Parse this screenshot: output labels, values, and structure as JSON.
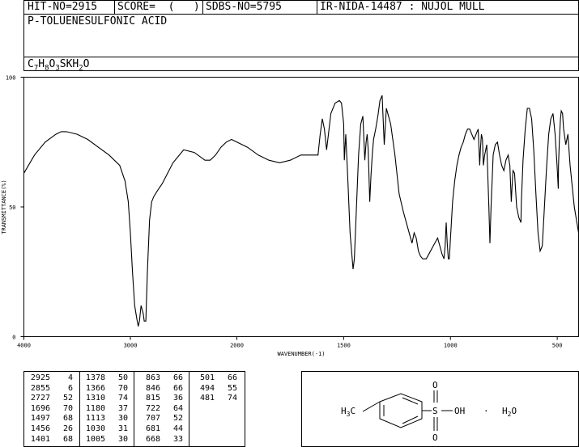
{
  "header": {
    "hit_no": "HIT-NO=2915",
    "score": "SCORE=  (   )",
    "sdbs_no": "SDBS-NO=5795",
    "ir_id": "IR-NIDA-14487 : NUJOL MULL",
    "compound_name": "P-TOLUENESULFONIC ACID",
    "formula_parts": [
      "C",
      "7",
      "H",
      "8",
      "O",
      "3",
      "SKH",
      "2",
      "O"
    ]
  },
  "chart_data": {
    "type": "line",
    "xlabel": "WAVENUMBER(-1)",
    "ylabel": "TRANSMITTANCE(%)",
    "xlim": [
      4000,
      400
    ],
    "ylim": [
      0,
      100
    ],
    "x_ticks": [
      "4000",
      "3000",
      "2000",
      "1500",
      "1000",
      "500"
    ],
    "y_ticks": [
      "0",
      "50",
      "100"
    ],
    "x_tick_values": [
      4000,
      3000,
      2000,
      1500,
      1000,
      500
    ],
    "y_tick_values": [
      0,
      50,
      100
    ],
    "series": [
      {
        "x": [
          4000,
          3900,
          3800,
          3700,
          3650,
          3600,
          3500,
          3400,
          3300,
          3200,
          3100,
          3050,
          3020,
          3000,
          2980,
          2960,
          2940,
          2926,
          2915,
          2900,
          2880,
          2870,
          2855,
          2840,
          2820,
          2800,
          2780,
          2750,
          2700,
          2650,
          2600,
          2500,
          2400,
          2300,
          2250,
          2200,
          2150,
          2100,
          2050,
          2000,
          1950,
          1900,
          1850,
          1800,
          1750,
          1700,
          1650,
          1620,
          1610,
          1600,
          1590,
          1580,
          1560,
          1540,
          1520,
          1510,
          1500,
          1497,
          1490,
          1480,
          1470,
          1456,
          1450,
          1440,
          1430,
          1420,
          1410,
          1401,
          1395,
          1390,
          1385,
          1378,
          1372,
          1366,
          1360,
          1350,
          1340,
          1330,
          1320,
          1310,
          1300,
          1290,
          1280,
          1260,
          1240,
          1220,
          1200,
          1180,
          1170,
          1160,
          1150,
          1140,
          1130,
          1120,
          1113,
          1100,
          1080,
          1060,
          1050,
          1040,
          1030,
          1025,
          1020,
          1015,
          1010,
          1005,
          1000,
          990,
          980,
          970,
          960,
          950,
          940,
          930,
          920,
          910,
          900,
          890,
          880,
          870,
          863,
          860,
          855,
          850,
          846,
          840,
          830,
          820,
          815,
          810,
          800,
          790,
          780,
          770,
          760,
          750,
          740,
          730,
          722,
          715,
          710,
          707,
          700,
          690,
          680,
          670,
          668,
          660,
          650,
          640,
          630,
          620,
          610,
          600,
          590,
          580,
          570,
          560,
          550,
          540,
          530,
          520,
          510,
          501,
          495,
          494,
          490,
          485,
          481,
          475,
          470,
          460,
          450,
          440,
          420,
          400
        ],
        "y": [
          63,
          70,
          75,
          78,
          79,
          79,
          78,
          76,
          73,
          70,
          66,
          60,
          52,
          40,
          25,
          12,
          7,
          4,
          6,
          12,
          9,
          6,
          6,
          25,
          45,
          52,
          54,
          56,
          59,
          63,
          67,
          72,
          71,
          68,
          68,
          70,
          73,
          75,
          76,
          75,
          73,
          70,
          68,
          67,
          68,
          70,
          70,
          70,
          78,
          84,
          80,
          72,
          86,
          90,
          91,
          90,
          82,
          68,
          78,
          60,
          40,
          26,
          30,
          50,
          70,
          82,
          85,
          68,
          75,
          78,
          72,
          52,
          62,
          70,
          76,
          80,
          85,
          91,
          93,
          74,
          88,
          85,
          82,
          70,
          55,
          48,
          42,
          36,
          40,
          38,
          33,
          31,
          30,
          30,
          30,
          32,
          35,
          38,
          35,
          32,
          30,
          35,
          44,
          36,
          30,
          30,
          38,
          52,
          60,
          66,
          70,
          73,
          75,
          78,
          80,
          80,
          78,
          76,
          78,
          80,
          66,
          72,
          78,
          76,
          66,
          70,
          74,
          50,
          36,
          50,
          70,
          74,
          75,
          70,
          66,
          64,
          68,
          70,
          66,
          52,
          60,
          64,
          63,
          50,
          46,
          44,
          52,
          68,
          80,
          88,
          88,
          84,
          72,
          55,
          40,
          33,
          35,
          50,
          65,
          78,
          84,
          86,
          78,
          66,
          57,
          66,
          76,
          84,
          87,
          86,
          80,
          74,
          78,
          66,
          50,
          40
        ]
      }
    ],
    "peak_table": {
      "columns": [
        [
          [
            "2925",
            "4"
          ],
          [
            "2855",
            "6"
          ],
          [
            "2727",
            "52"
          ],
          [
            "1696",
            "70"
          ],
          [
            "1497",
            "68"
          ],
          [
            "1456",
            "26"
          ],
          [
            "1401",
            "68"
          ]
        ],
        [
          [
            "1378",
            "50"
          ],
          [
            "1366",
            "70"
          ],
          [
            "1310",
            "74"
          ],
          [
            "1180",
            "37"
          ],
          [
            "1113",
            "30"
          ],
          [
            "1030",
            "31"
          ],
          [
            "1005",
            "30"
          ]
        ],
        [
          [
            "863",
            "66"
          ],
          [
            "846",
            "66"
          ],
          [
            "815",
            "36"
          ],
          [
            "722",
            "64"
          ],
          [
            "707",
            "52"
          ],
          [
            "681",
            "44"
          ],
          [
            "668",
            "33"
          ]
        ],
        [
          [
            "501",
            "66"
          ],
          [
            "494",
            "55"
          ],
          [
            "481",
            "74"
          ]
        ]
      ]
    }
  },
  "structure": {
    "methyl": "H3C",
    "sulfonyl_o_top": "O",
    "sulfonyl_o_bottom": "O",
    "sulfur": "S",
    "hydroxyl": "OH",
    "dot": "·",
    "water": "H2O"
  }
}
